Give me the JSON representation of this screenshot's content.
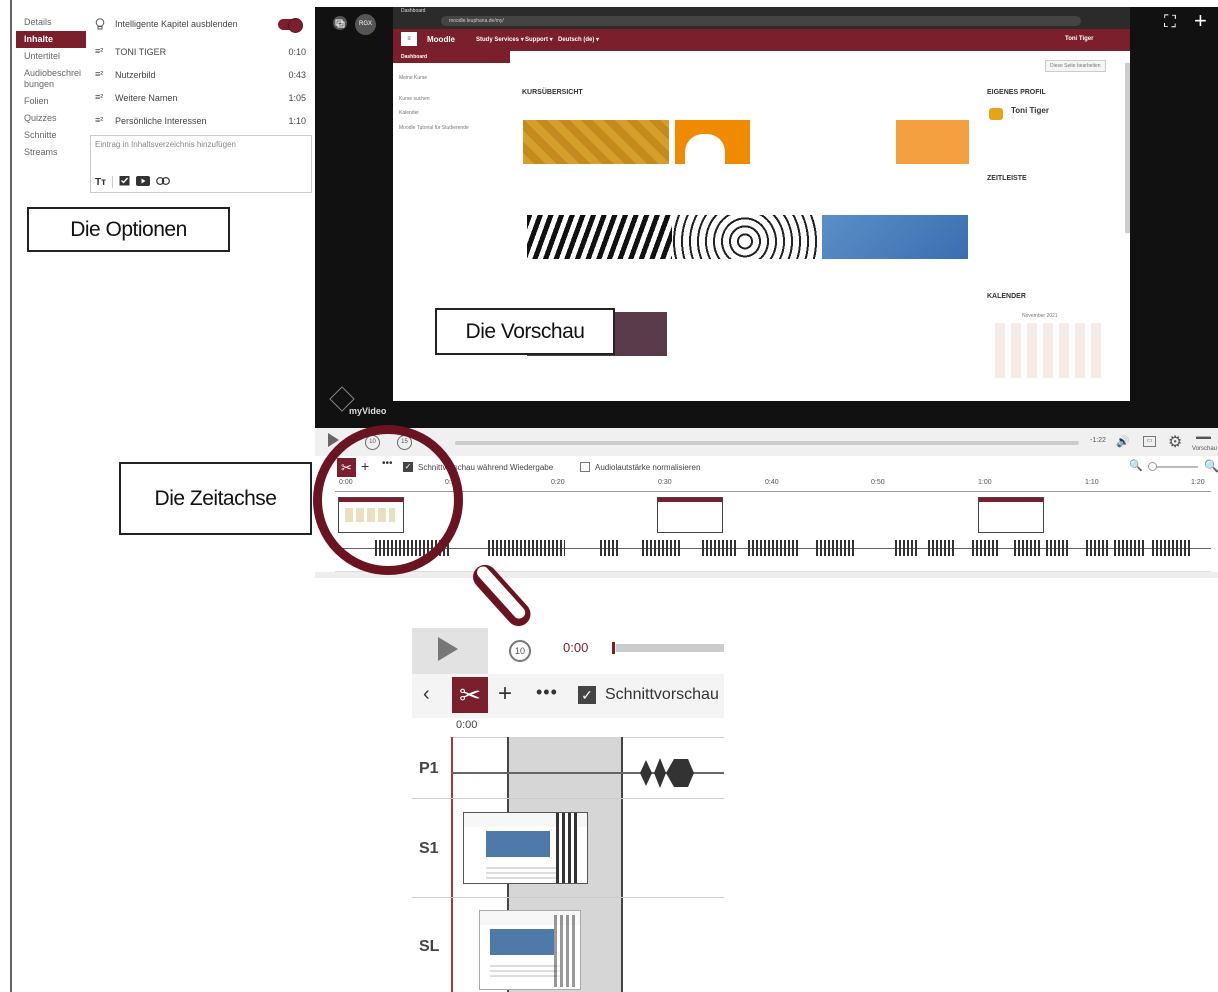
{
  "options_panel": {
    "nav": [
      "Details",
      "Inhalte",
      "Untertitel",
      "Audiobeschrei bungen",
      "Folien",
      "Quizzes",
      "Schnitte",
      "Streams"
    ],
    "active_nav": "Inhalte",
    "toggle_label": "Intelligente Kapitel ausblenden",
    "chapters": [
      {
        "label": "TONI TIGER",
        "time": "0:10"
      },
      {
        "label": "Nutzerbild",
        "time": "0:43"
      },
      {
        "label": "Weitere Namen",
        "time": "1:05"
      },
      {
        "label": "Persönliche Interessen",
        "time": "1:10"
      }
    ],
    "toc_placeholder": "Eintrag in Inhaltsverzeichnis hinzufügen",
    "toc_text_tool": "Tт"
  },
  "callouts": {
    "options": "Die Optionen",
    "preview": "Die Vorschau",
    "timeline": "Die Zeitachse"
  },
  "preview": {
    "avatar_badge": "RGX",
    "url": "moodle.leuphana.de/my/",
    "moodle_brand": "Moodle",
    "moodle_menu": [
      "Study Services ▾",
      "Support ▾",
      "Deutsch (de) ▾"
    ],
    "user_name": "Toni Tiger",
    "dashboard_tab": "Dashboard",
    "edit_button": "Diese Seite bearbeiten",
    "sidebar_items": [
      "Meine Kurse",
      "Kurse suchen",
      "Kalender",
      "Moodle Tutorial für Studierende"
    ],
    "section_courses": "KURSÜBERSICHT",
    "section_profile": "EIGENES PROFIL",
    "section_timeline": "ZEITLEISTE",
    "section_calendar": "KALENDER",
    "calendar_month": "November 2021",
    "profile_name": "Toni Tiger",
    "logo_text": "myVideo"
  },
  "player": {
    "time_remaining": "-1:22",
    "replay_label": "10",
    "forward_label": "15",
    "preview_label": "Vorschau",
    "checkbox1_label": "Schnittvorschau während Wiedergabe",
    "checkbox2_label": "Audiolautstärke normalisieren",
    "ruler_ticks": [
      "0:00",
      "0:10",
      "0:20",
      "0:30",
      "0:40",
      "0:50",
      "1:00",
      "1:10",
      "1:20"
    ]
  },
  "zoom_detail": {
    "time": "0:00",
    "replay_label": "10",
    "checkbox_label": "Schnittvorschau",
    "ruler_start": "0:00",
    "tracks": [
      "P1",
      "S1",
      "SL"
    ]
  }
}
